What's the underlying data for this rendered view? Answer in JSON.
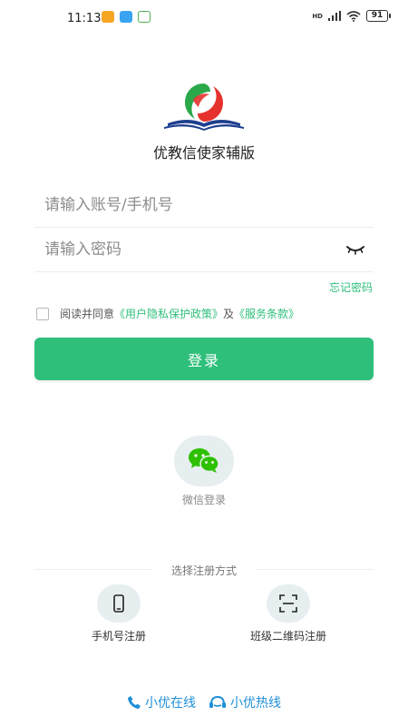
{
  "status_bar": {
    "time": "11:13",
    "battery": "91",
    "network": "HD"
  },
  "app": {
    "title": "优教信使家辅版"
  },
  "login_form": {
    "account_placeholder": "请输入账号/手机号",
    "password_placeholder": "请输入密码",
    "forgot_password": "忘记密码",
    "agreement_prefix": "阅读并同意",
    "privacy_link": "《用户隐私保护政策》",
    "agreement_and": "及",
    "terms_link": "《服务条款》",
    "login_label": "登录"
  },
  "wechat_login": {
    "label": "微信登录"
  },
  "register": {
    "title": "选择注册方式",
    "options": [
      {
        "label": "手机号注册",
        "icon": "phone-icon"
      },
      {
        "label": "班级二维码注册",
        "icon": "qr-scan-icon"
      }
    ]
  },
  "support": {
    "online": "小优在线",
    "hotline": "小优热线"
  },
  "colors": {
    "accent": "#2ebf7a",
    "link_blue": "#1f8fd8"
  }
}
